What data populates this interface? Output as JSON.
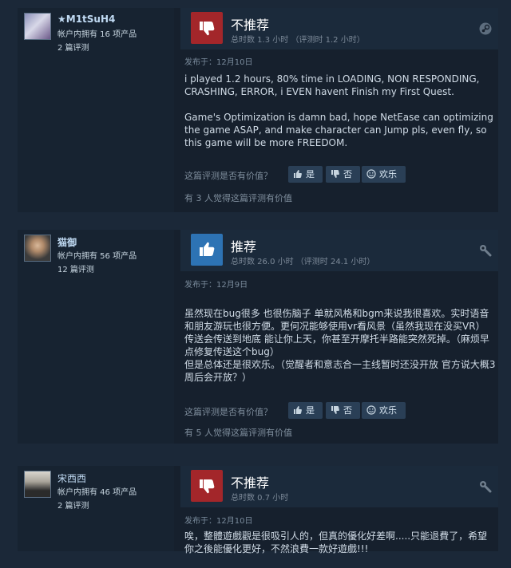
{
  "reviews": [
    {
      "username": "★M1tSuH4",
      "products": "帐户内拥有 16 项产品",
      "review_count": "2 篇评测",
      "verdict": "不推荐",
      "hours": "总时数 1.3 小时 （评测时 1.2 小时）",
      "posted": "发布于：12月10日",
      "body": [
        "i played 1.2 hours, 80% time in LOADING, NON RESPONDING, CRASHING, ERROR, i EVEN havent Finish my First Quest.",
        "Game's Optimization is damn bad, hope NetEase can optimizing the game ASAP, and make character can Jump pls, even fly, so this game will be more FREEDOM."
      ],
      "helpful_q": "这篇评测是否有价值？",
      "yes": "是",
      "no": "否",
      "funny": "欢乐",
      "found_helpful": "有 3 人觉得这篇评测有价值",
      "corner_icon": "steam-icon"
    },
    {
      "username": "猫御",
      "products": "帐户内拥有 56 项产品",
      "review_count": "12 篇评测",
      "verdict": "推荐",
      "hours": "总时数 26.0 小时 （评测时 24.1 小时）",
      "posted": "发布于：12月9日",
      "body": [
        "虽然现在bug很多 也很伤脑子 单就风格和bgm来说我很喜欢。实时语音和朋友游玩也很方便。更何况能够使用vr看风景（虽然我现在没买VR）\n传送会传送到地底 能让你上天，你甚至开摩托半路能突然死掉。（麻烦早点修复传送这个bug）\n但是总体还是很欢乐。（觉醒者和意志合一主线暂时还没开放 官方说大概3周后会开放？）"
      ],
      "helpful_q": "这篇评测是否有价值？",
      "yes": "是",
      "no": "否",
      "funny": "欢乐",
      "found_helpful": "有 5 人觉得这篇评测有价值",
      "corner_icon": "wrench-icon"
    },
    {
      "username": "宋西西",
      "products": "帐户内拥有 46 项产品",
      "review_count": "2 篇评测",
      "verdict": "不推荐",
      "hours": "总时数 0.7 小时",
      "posted": "发布于：12月10日",
      "body": [
        "唉，整體遊戲觀是很吸引人的，但真的優化好差啊.....只能退費了，希望你之後能優化更好，不然浪費一款好遊戲!!!"
      ],
      "corner_icon": "wrench-icon"
    }
  ],
  "colors": {
    "page_bg": "#1b2838",
    "not_recommended": "#a3262a",
    "recommended": "#2d73b4",
    "username": "#c1dbf4"
  }
}
